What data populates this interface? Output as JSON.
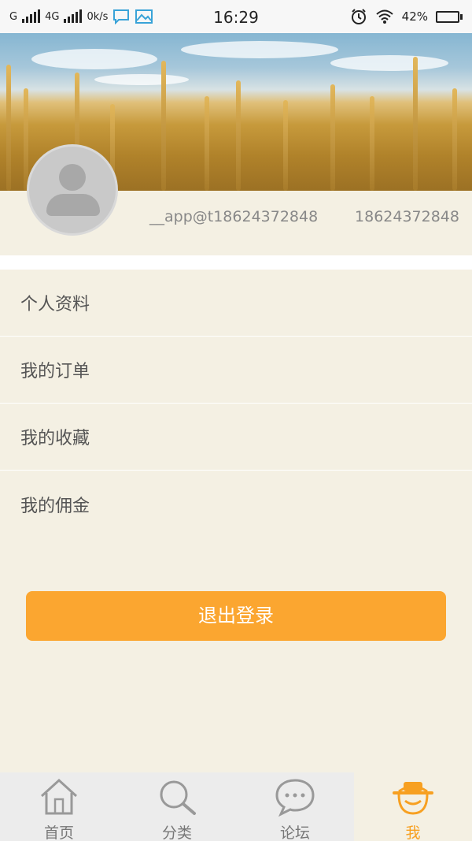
{
  "status_bar": {
    "carrier1": "G",
    "carrier2": "4G",
    "speed": "0k/s",
    "time": "16:29",
    "battery": "42%",
    "battery_level": 0.42
  },
  "profile": {
    "username": "__app@t18624372848",
    "phone": "18624372848"
  },
  "menu": {
    "items": [
      {
        "label": "个人资料"
      },
      {
        "label": "我的订单"
      },
      {
        "label": "我的收藏"
      },
      {
        "label": "我的佣金"
      }
    ]
  },
  "logout_label": "退出登录",
  "tabs": [
    {
      "label": "首页",
      "icon": "home-icon"
    },
    {
      "label": "分类",
      "icon": "search-icon"
    },
    {
      "label": "论坛",
      "icon": "chat-icon"
    },
    {
      "label": "我",
      "icon": "farmer-hat-icon",
      "active": true
    }
  ],
  "colors": {
    "accent": "#fba630",
    "background": "#f4f0e3",
    "tab_active": "#f7a021"
  }
}
